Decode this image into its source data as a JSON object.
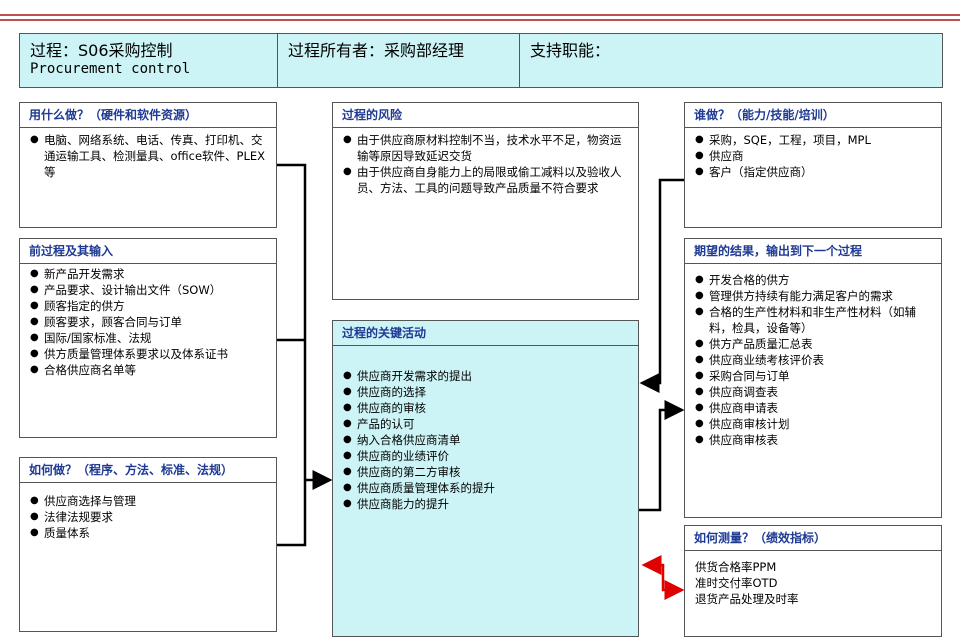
{
  "header": {
    "process_label": "过程：S06采购控制",
    "process_en": "Procurement control",
    "owner_label": "过程所有者：采购部经理",
    "support_label": "支持职能："
  },
  "resources": {
    "title": "用什么做？（硬件和软件资源）",
    "items": [
      "电脑、网络系统、电话、传真、打印机、交通运输工具、检测量具、office软件、PLEX等"
    ]
  },
  "risks": {
    "title": "过程的风险",
    "items": [
      "由于供应商原材料控制不当，技术水平不足，物资运输等原因导致延迟交货",
      "由于供应商自身能力上的局限或偷工减料以及验收人员、方法、工具的问题导致产品质量不符合要求"
    ]
  },
  "who": {
    "title": "谁做？（能力/技能/培训）",
    "items": [
      "采购，SQE，工程，项目，MPL",
      "供应商",
      "客户（指定供应商）"
    ]
  },
  "inputs": {
    "title": "前过程及其输入",
    "items": [
      "新产品开发需求",
      "产品要求、设计输出文件（SOW）",
      "顾客指定的供方",
      "顾客要求，顾客合同与订单",
      "国际/国家标准、法规",
      "供方质量管理体系要求以及体系证书",
      "合格供应商名单等"
    ]
  },
  "outputs": {
    "title": "期望的结果，输出到下一个过程",
    "items": [
      "开发合格的供方",
      "管理供方持续有能力满足客户的需求",
      "合格的生产性材料和非生产性材料（如辅料，检具，设备等）",
      "供方产品质量汇总表",
      "供应商业绩考核评价表",
      "采购合同与订单",
      "供应商调查表",
      "供应商申请表",
      "供应商审核计划",
      "供应商审核表"
    ]
  },
  "activities": {
    "title": "过程的关键活动",
    "items": [
      "供应商开发需求的提出",
      "供应商的选择",
      "供应商的审核",
      "产品的认可",
      "纳入合格供应商清单",
      "供应商的业绩评价",
      "供应商的第二方审核",
      "供应商质量管理体系的提升",
      "供应商能力的提升"
    ]
  },
  "how": {
    "title": "如何做？（程序、方法、标准、法规）",
    "items": [
      "供应商选择与管理",
      "法律法规要求",
      "质量体系"
    ]
  },
  "measure": {
    "title": "如何测量？（绩效指标）",
    "lines": [
      "供货合格率PPM",
      "准时交付率OTD",
      "退货产品处理及时率"
    ]
  },
  "colors": {
    "header_bg": "#ccf3f5",
    "title_text": "#1f3a93",
    "accent_line": "#c0504d",
    "measure_arrow": "#e00000"
  }
}
